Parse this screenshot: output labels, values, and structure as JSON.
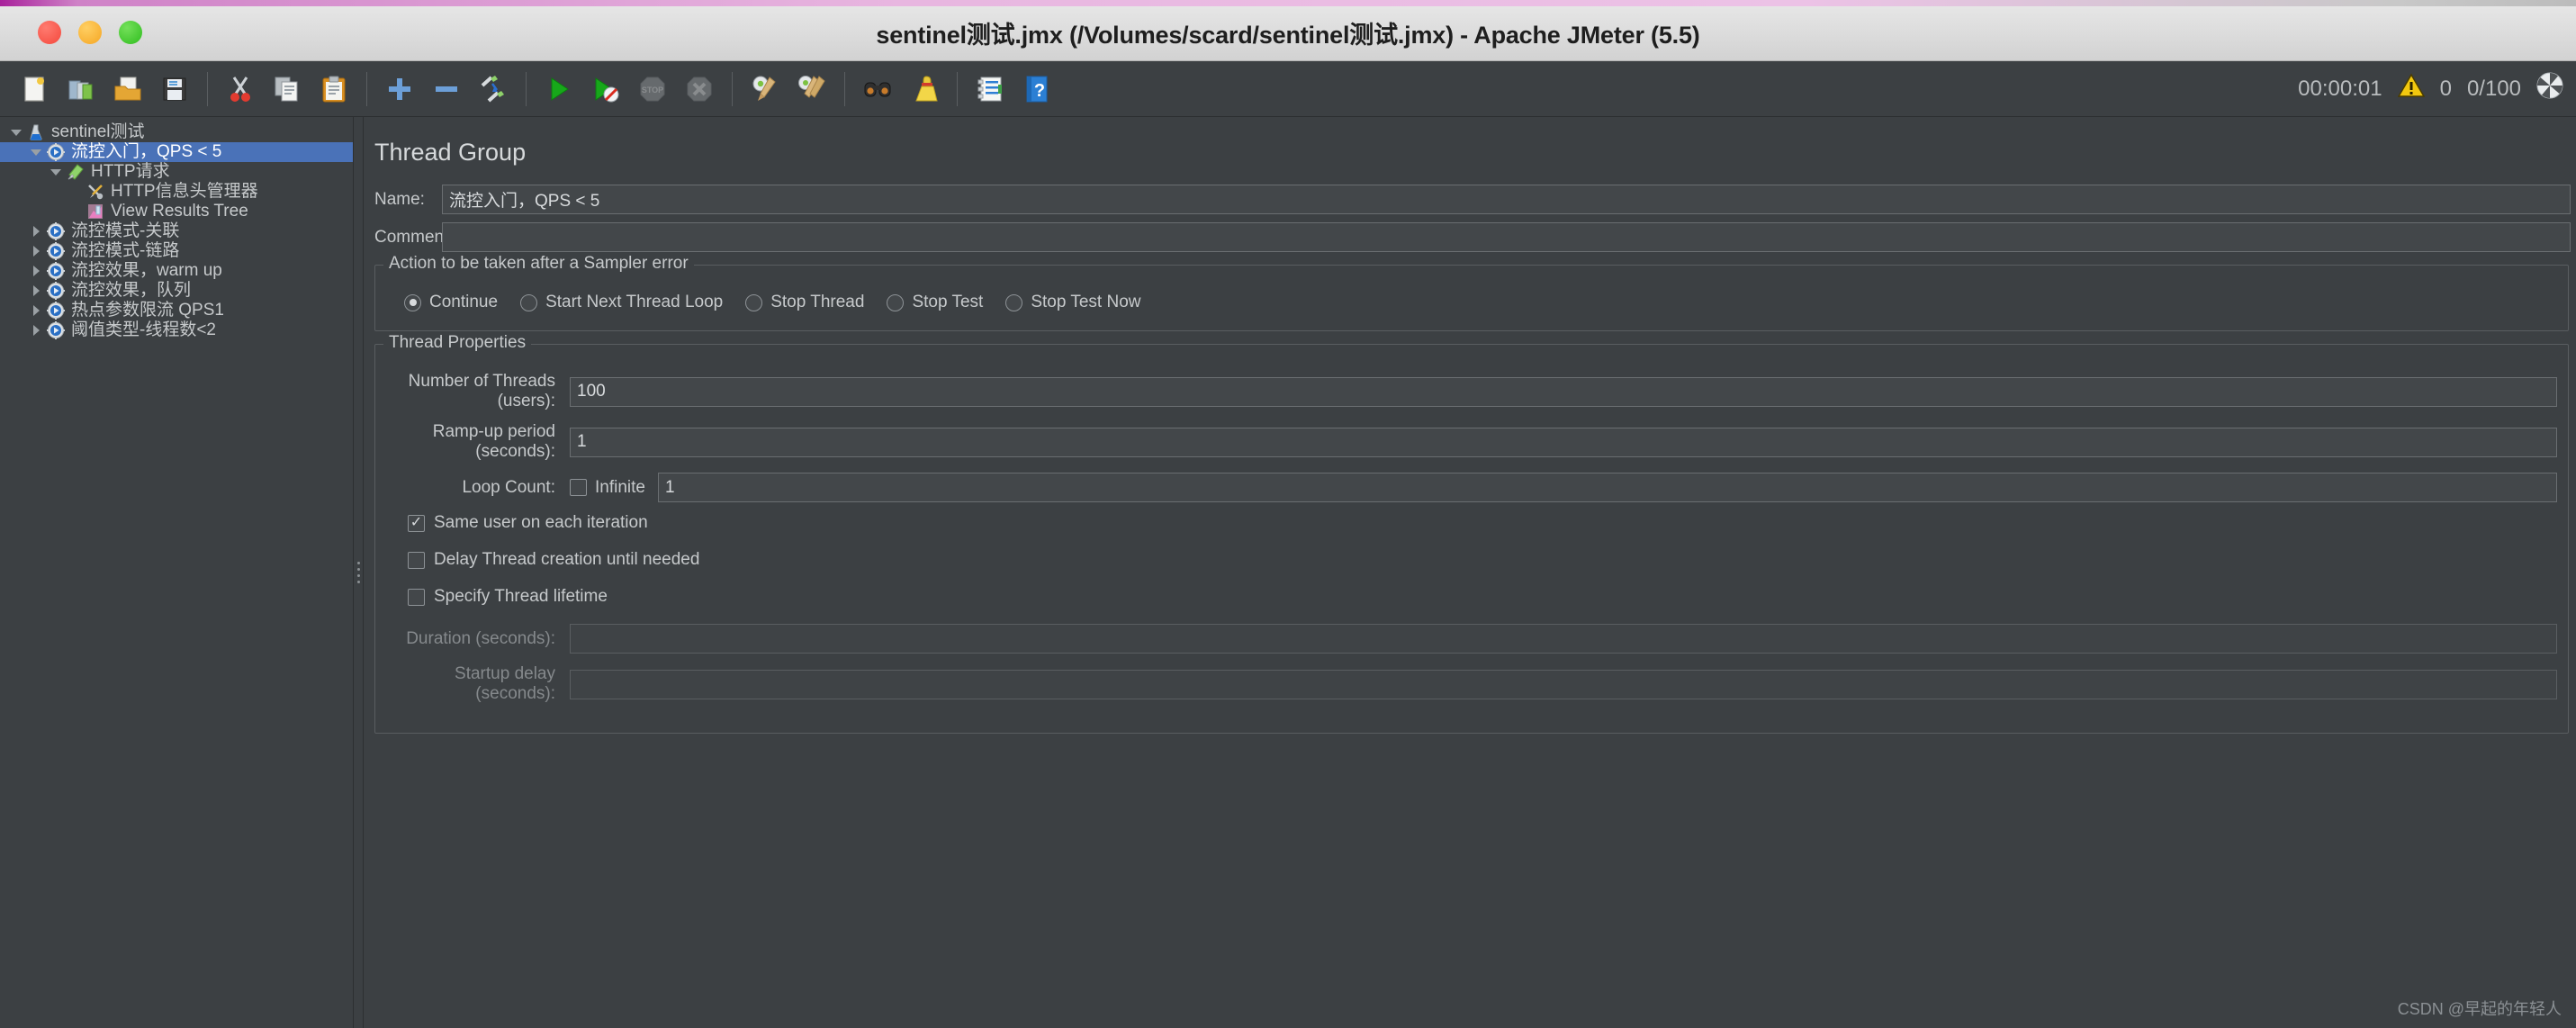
{
  "window": {
    "title": "sentinel测试.jmx (/Volumes/scard/sentinel测试.jmx) - Apache JMeter (5.5)",
    "traffic_lights": [
      "close",
      "minimize",
      "zoom"
    ]
  },
  "toolbar": {
    "buttons": [
      {
        "name": "new-icon",
        "label": "New"
      },
      {
        "name": "templates-icon",
        "label": "Templates"
      },
      {
        "name": "open-icon",
        "label": "Open"
      },
      {
        "name": "save-icon",
        "label": "Save Test Plan"
      },
      {
        "name": "cut-icon",
        "label": "Cut"
      },
      {
        "name": "copy-icon",
        "label": "Copy"
      },
      {
        "name": "paste-icon",
        "label": "Paste"
      },
      {
        "name": "expand-all-icon",
        "label": "Expand All"
      },
      {
        "name": "collapse-all-icon",
        "label": "Collapse All"
      },
      {
        "name": "toggle-icon",
        "label": "Toggle"
      },
      {
        "name": "start-icon",
        "label": "Start"
      },
      {
        "name": "start-no-pauses-icon",
        "label": "Start no pauses"
      },
      {
        "name": "stop-icon",
        "label": "Stop"
      },
      {
        "name": "shutdown-icon",
        "label": "Shutdown"
      },
      {
        "name": "clear-icon",
        "label": "Clear"
      },
      {
        "name": "clear-all-icon",
        "label": "Clear All"
      },
      {
        "name": "search-icon",
        "label": "Search"
      },
      {
        "name": "reset-search-icon",
        "label": "Reset Search"
      },
      {
        "name": "function-helper-icon",
        "label": "Function Helper Dialog"
      },
      {
        "name": "help-icon",
        "label": "Help"
      }
    ],
    "status": {
      "elapsed": "00:00:01",
      "warning_icon": "warning-triangle-icon",
      "error_count": "0",
      "threads": "0/100",
      "activity_icon": "activity-indicator-icon"
    }
  },
  "tree": {
    "items": [
      {
        "label": "sentinel测试",
        "depth": 0,
        "toggle": "down",
        "icon": "test-plan-icon",
        "selected": false
      },
      {
        "label": "流控入门，QPS < 5",
        "depth": 1,
        "toggle": "down",
        "icon": "thread-group-icon",
        "selected": true
      },
      {
        "label": "HTTP请求",
        "depth": 2,
        "toggle": "down",
        "icon": "http-sampler-icon",
        "selected": false
      },
      {
        "label": "HTTP信息头管理器",
        "depth": 3,
        "toggle": "none",
        "icon": "header-manager-icon",
        "selected": false
      },
      {
        "label": "View Results Tree",
        "depth": 3,
        "toggle": "none",
        "icon": "view-results-tree-icon",
        "selected": false
      },
      {
        "label": "流控模式-关联",
        "depth": 1,
        "toggle": "right",
        "icon": "thread-group-icon",
        "selected": false
      },
      {
        "label": "流控模式-链路",
        "depth": 1,
        "toggle": "right",
        "icon": "thread-group-icon",
        "selected": false
      },
      {
        "label": "流控效果，warm up",
        "depth": 1,
        "toggle": "right",
        "icon": "thread-group-icon",
        "selected": false
      },
      {
        "label": "流控效果，队列",
        "depth": 1,
        "toggle": "right",
        "icon": "thread-group-icon",
        "selected": false
      },
      {
        "label": "热点参数限流 QPS1",
        "depth": 1,
        "toggle": "right",
        "icon": "thread-group-icon",
        "selected": false
      },
      {
        "label": "阈值类型-线程数<2",
        "depth": 1,
        "toggle": "right",
        "icon": "thread-group-icon",
        "selected": false
      }
    ]
  },
  "panel": {
    "title": "Thread Group",
    "name_label": "Name:",
    "name_value": "流控入门，QPS < 5",
    "comments_label": "Comments:",
    "comments_value": "",
    "error_action": {
      "legend": "Action to be taken after a Sampler error",
      "options": [
        {
          "label": "Continue",
          "checked": true
        },
        {
          "label": "Start Next Thread Loop",
          "checked": false
        },
        {
          "label": "Stop Thread",
          "checked": false
        },
        {
          "label": "Stop Test",
          "checked": false
        },
        {
          "label": "Stop Test Now",
          "checked": false
        }
      ]
    },
    "thread_properties": {
      "legend": "Thread Properties",
      "num_threads_label": "Number of Threads (users):",
      "num_threads_value": "100",
      "ramp_up_label": "Ramp-up period (seconds):",
      "ramp_up_value": "1",
      "loop_count_label": "Loop Count:",
      "infinite_label": "Infinite",
      "infinite_checked": false,
      "loop_count_value": "1",
      "same_user_label": "Same user on each iteration",
      "same_user_checked": true,
      "delay_thread_label": "Delay Thread creation until needed",
      "delay_thread_checked": false,
      "specify_lifetime_label": "Specify Thread lifetime",
      "specify_lifetime_checked": false,
      "duration_label": "Duration (seconds):",
      "duration_value": "",
      "startup_delay_label": "Startup delay (seconds):",
      "startup_delay_value": ""
    }
  },
  "watermark": "CSDN @早起的年轻人",
  "colors": {
    "background": "#3c4043",
    "selection": "#4a72b8",
    "text": "#c6c9cb",
    "field_bg": "#43474a",
    "border": "#6a6e71"
  }
}
